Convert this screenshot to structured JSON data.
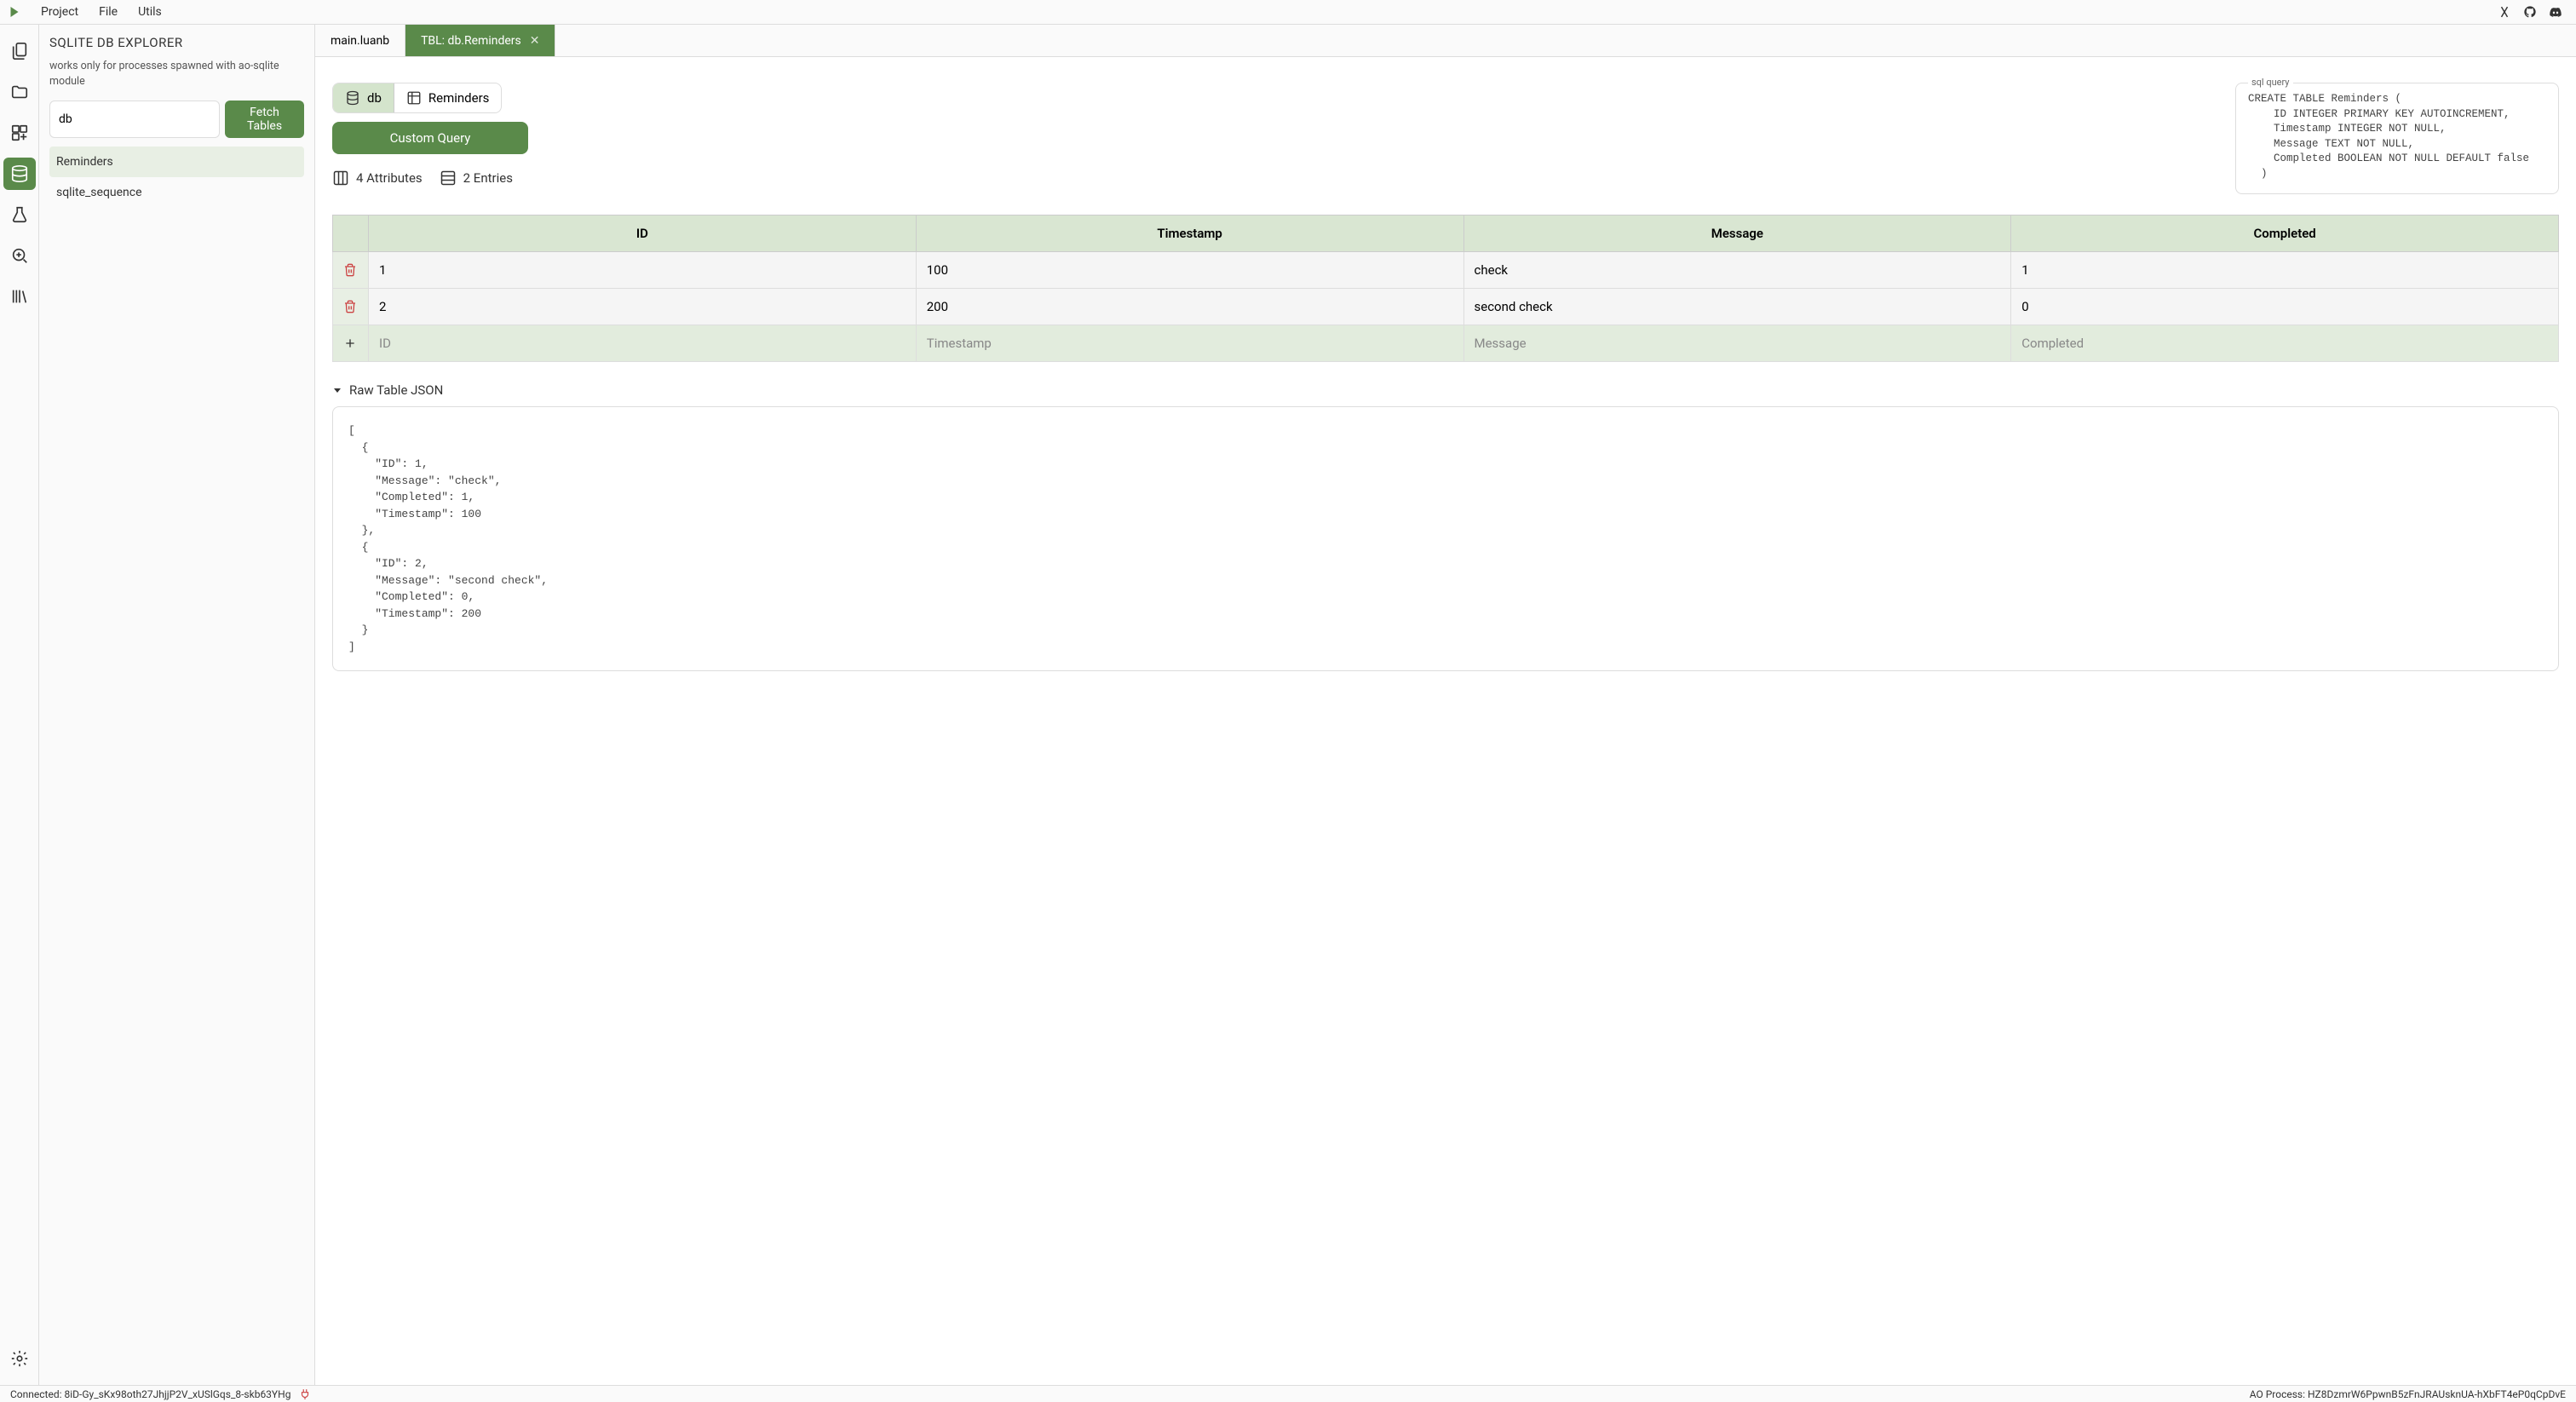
{
  "menu": {
    "items": [
      "Project",
      "File",
      "Utils"
    ]
  },
  "sidebar": {
    "title": "SQLITE DB EXPLORER",
    "description": "works only for processes spawned with ao-sqlite module",
    "db_input_value": "db",
    "fetch_button": "Fetch Tables",
    "tables": [
      "Reminders",
      "sqlite_sequence"
    ],
    "active_table_index": 0
  },
  "tabs": [
    {
      "label": "main.luanb",
      "active": false,
      "closable": false
    },
    {
      "label": "TBL: db.Reminders",
      "active": true,
      "closable": true
    }
  ],
  "breadcrumb": {
    "db": "db",
    "table": "Reminders"
  },
  "custom_query_button": "Custom Query",
  "stats": {
    "attributes_count": "4 Attributes",
    "entries_count": "2 Entries"
  },
  "sql_query": {
    "legend": "sql query",
    "content": "CREATE TABLE Reminders (\n    ID INTEGER PRIMARY KEY AUTOINCREMENT,\n    Timestamp INTEGER NOT NULL,\n    Message TEXT NOT NULL,\n    Completed BOOLEAN NOT NULL DEFAULT false\n  )"
  },
  "table_data": {
    "columns": [
      "ID",
      "Timestamp",
      "Message",
      "Completed"
    ],
    "rows": [
      {
        "ID": "1",
        "Timestamp": "100",
        "Message": "check",
        "Completed": "1"
      },
      {
        "ID": "2",
        "Timestamp": "200",
        "Message": "second check",
        "Completed": "0"
      }
    ],
    "placeholders": {
      "ID": "ID",
      "Timestamp": "Timestamp",
      "Message": "Message",
      "Completed": "Completed"
    }
  },
  "raw_json": {
    "title": "Raw Table JSON",
    "content": "[\n  {\n    \"ID\": 1,\n    \"Message\": \"check\",\n    \"Completed\": 1,\n    \"Timestamp\": 100\n  },\n  {\n    \"ID\": 2,\n    \"Message\": \"second check\",\n    \"Completed\": 0,\n    \"Timestamp\": 200\n  }\n]"
  },
  "status_bar": {
    "connected": "Connected: 8iD-Gy_sKx98oth27JhjjP2V_xUSlGqs_8-skb63YHg",
    "ao_process": "AO Process: HZ8DzmrW6PpwnB5zFnJRAUsknUA-hXbFT4eP0qCpDvE"
  }
}
